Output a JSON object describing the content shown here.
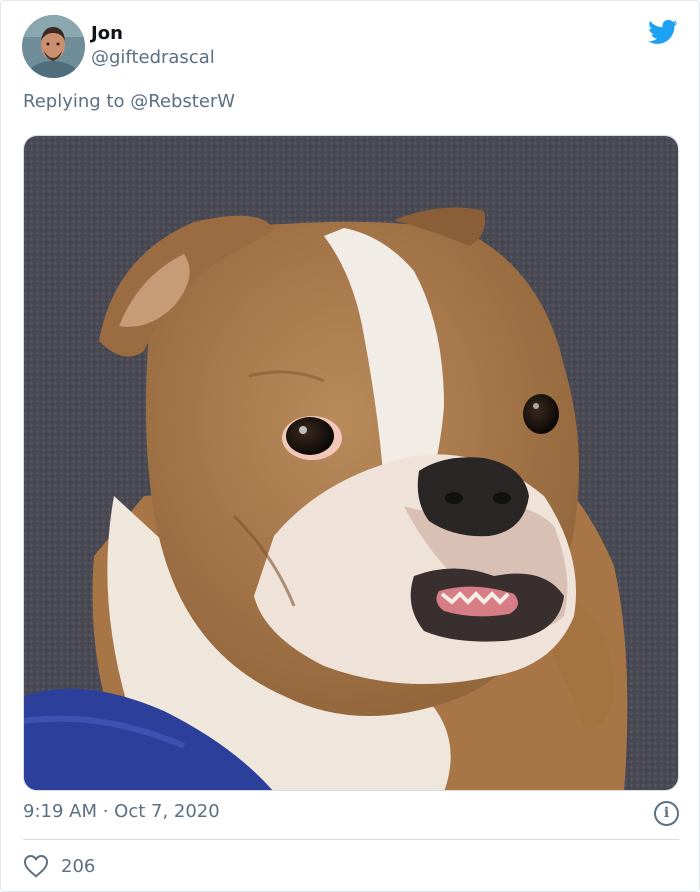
{
  "tweet": {
    "author_name": "Jon",
    "author_handle": "@giftedrascal",
    "reply_prefix": "Replying to ",
    "reply_to": "@RebsterW",
    "timestamp": "9:19 AM · Oct 7, 2020",
    "like_count": "206"
  },
  "icons": {
    "brand": "twitter-bird-icon",
    "info": "info-icon",
    "like": "heart-icon"
  },
  "colors": {
    "twitter_blue": "#1da1f2",
    "secondary_text": "#5b7083",
    "divider": "#d5dde3"
  }
}
